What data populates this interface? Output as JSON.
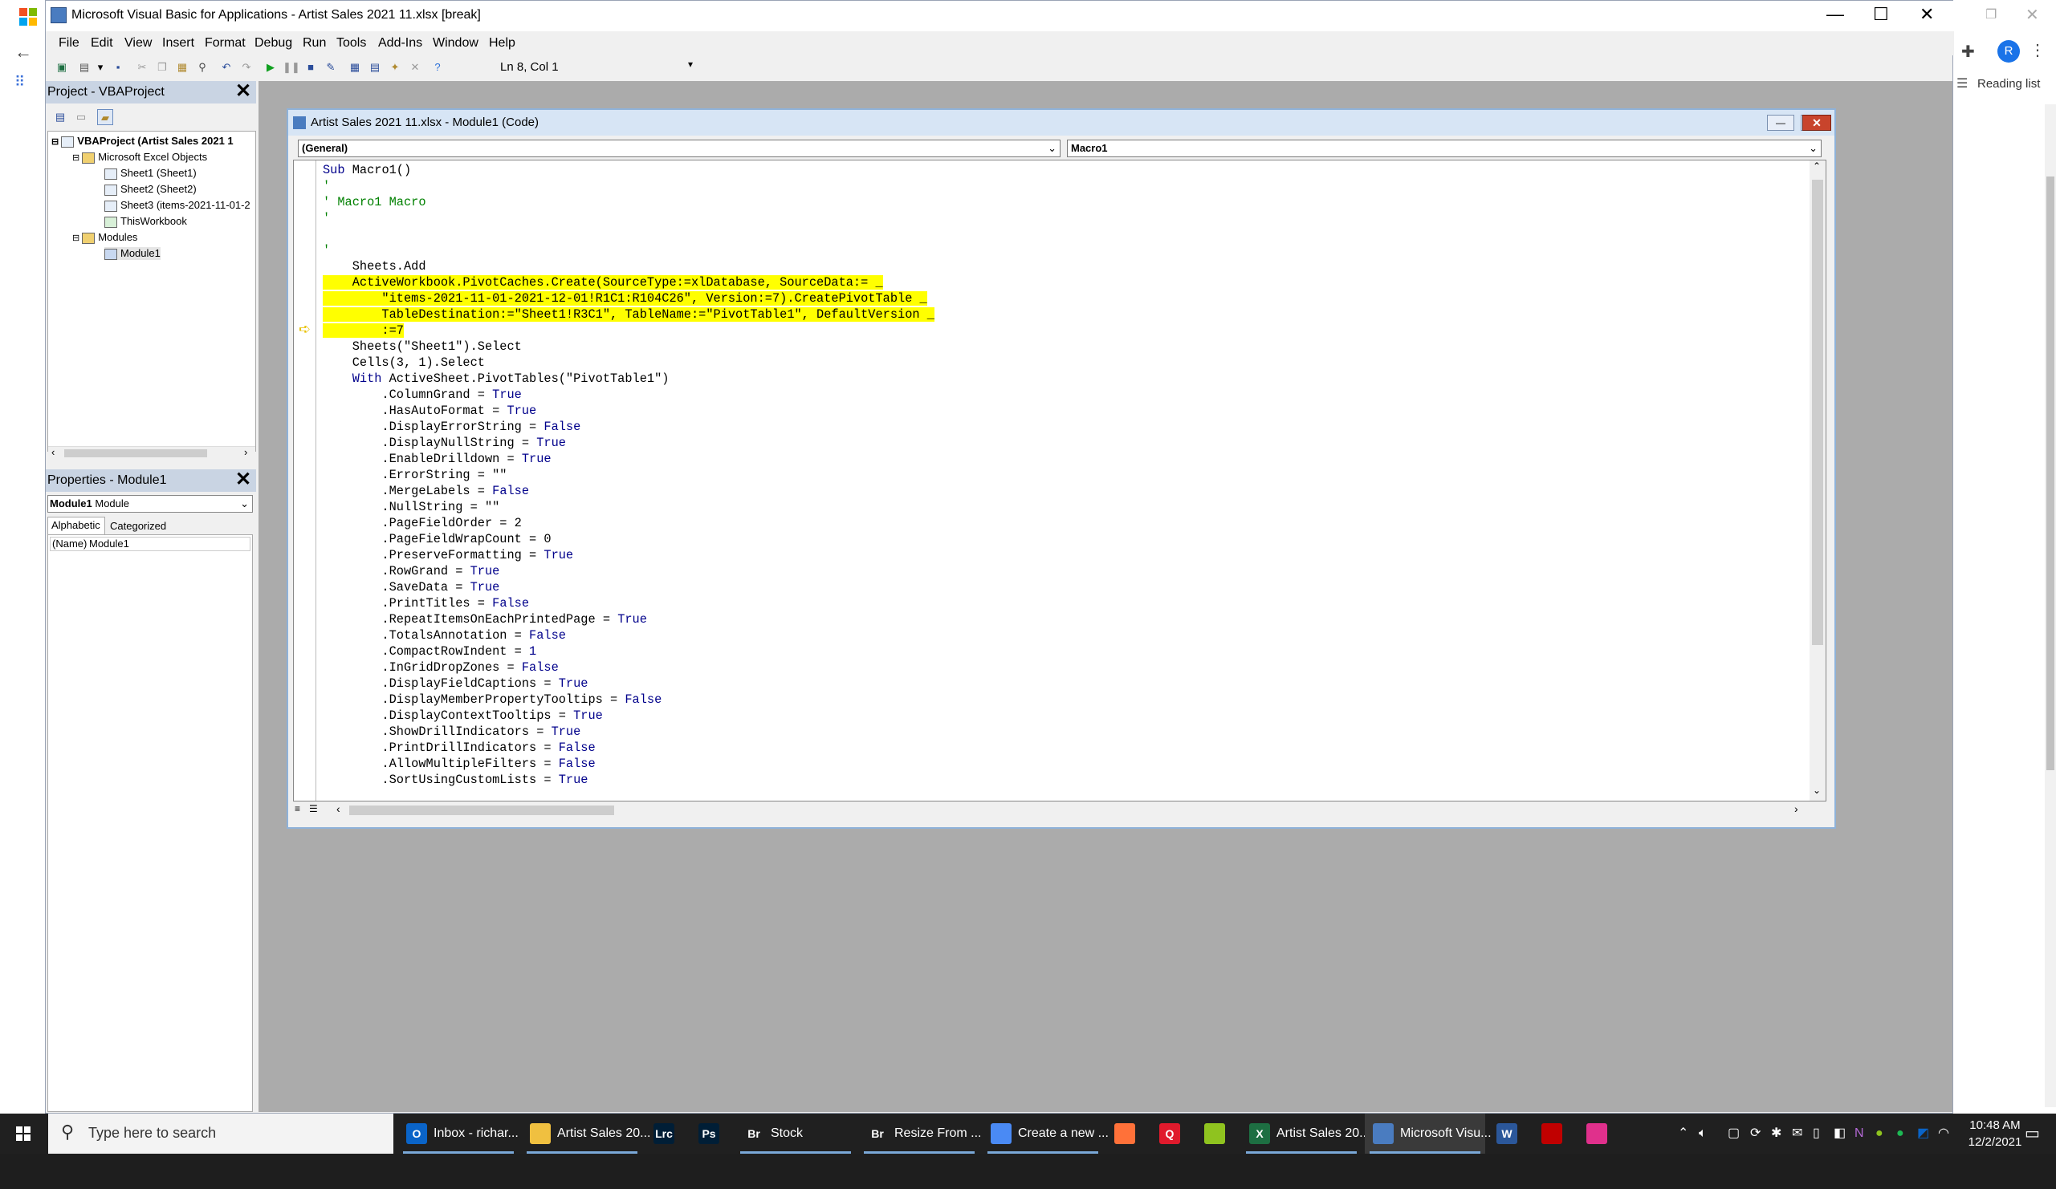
{
  "window_title": "Microsoft Visual Basic for Applications - Artist Sales 2021 11.xlsx [break]",
  "browser": {
    "reading_list": "Reading list",
    "avatar_initial": "R"
  },
  "menu": [
    "File",
    "Edit",
    "View",
    "Insert",
    "Format",
    "Debug",
    "Run",
    "Tools",
    "Add-Ins",
    "Window",
    "Help"
  ],
  "toolbar": {
    "position_text": "Ln 8, Col 1"
  },
  "project_panel": {
    "title": "Project - VBAProject",
    "tree": [
      {
        "label": "VBAProject (Artist Sales 2021 1",
        "icon": "vbaproject-icon"
      },
      {
        "label": "Microsoft Excel Objects",
        "icon": "folder-icon"
      },
      {
        "label": "Sheet1 (Sheet1)",
        "icon": "sheet-icon"
      },
      {
        "label": "Sheet2 (Sheet2)",
        "icon": "sheet-icon"
      },
      {
        "label": "Sheet3 (items-2021-11-01-2",
        "icon": "sheet-icon"
      },
      {
        "label": "ThisWorkbook",
        "icon": "workbook-icon"
      },
      {
        "label": "Modules",
        "icon": "folder-icon"
      },
      {
        "label": "Module1",
        "icon": "module-icon"
      }
    ]
  },
  "properties_panel": {
    "title": "Properties - Module1",
    "selected_object": "Module1",
    "selected_type": "Module",
    "tabs": [
      "Alphabetic",
      "Categorized"
    ],
    "rows": [
      {
        "name": "(Name)",
        "value": "Module1"
      }
    ]
  },
  "code_window": {
    "title": "Artist Sales 2021 11.xlsx - Module1 (Code)",
    "object_combo": "(General)",
    "procedure_combo": "Macro1",
    "lines": [
      {
        "t": "Sub Macro1()",
        "k": "sub"
      },
      {
        "t": "'",
        "k": "comment"
      },
      {
        "t": "' Macro1 Macro",
        "k": "comment"
      },
      {
        "t": "'",
        "k": "comment"
      },
      {
        "t": "",
        "k": "plain"
      },
      {
        "t": "'",
        "k": "comment"
      },
      {
        "t": "    Sheets.Add",
        "k": "plain"
      },
      {
        "t": "    ActiveWorkbook.PivotCaches.Create(SourceType:=xlDatabase, SourceData:= _",
        "k": "hl"
      },
      {
        "t": "        \"items-2021-11-01-2021-12-01!R1C1:R104C26\", Version:=7).CreatePivotTable _",
        "k": "hl"
      },
      {
        "t": "        TableDestination:=\"Sheet1!R3C1\", TableName:=\"PivotTable1\", DefaultVersion _",
        "k": "hl"
      },
      {
        "t": "        :=7",
        "k": "hl"
      },
      {
        "t": "    Sheets(\"Sheet1\").Select",
        "k": "plain"
      },
      {
        "t": "    Cells(3, 1).Select",
        "k": "plain"
      },
      {
        "t": "    With ActiveSheet.PivotTables(\"PivotTable1\")",
        "k": "with"
      },
      {
        "t": "        .ColumnGrand = ",
        "v": "True"
      },
      {
        "t": "        .HasAutoFormat = ",
        "v": "True"
      },
      {
        "t": "        .DisplayErrorString = ",
        "v": "False"
      },
      {
        "t": "        .DisplayNullString = ",
        "v": "True"
      },
      {
        "t": "        .EnableDrilldown = ",
        "v": "True"
      },
      {
        "t": "        .ErrorString = \"\"",
        "k": "plain"
      },
      {
        "t": "        .MergeLabels = ",
        "v": "False"
      },
      {
        "t": "        .NullString = \"\"",
        "k": "plain"
      },
      {
        "t": "        .PageFieldOrder = 2",
        "k": "plain"
      },
      {
        "t": "        .PageFieldWrapCount = 0",
        "k": "plain"
      },
      {
        "t": "        .PreserveFormatting = ",
        "v": "True"
      },
      {
        "t": "        .RowGrand = ",
        "v": "True"
      },
      {
        "t": "        .SaveData = ",
        "v": "True"
      },
      {
        "t": "        .PrintTitles = ",
        "v": "False"
      },
      {
        "t": "        .RepeatItemsOnEachPrintedPage = ",
        "v": "True"
      },
      {
        "t": "        .TotalsAnnotation = ",
        "v": "False"
      },
      {
        "t": "        .CompactRowIndent = ",
        "v": "1"
      },
      {
        "t": "        .InGridDropZones = ",
        "v": "False"
      },
      {
        "t": "        .DisplayFieldCaptions = ",
        "v": "True"
      },
      {
        "t": "        .DisplayMemberPropertyTooltips = ",
        "v": "False"
      },
      {
        "t": "        .DisplayContextTooltips = ",
        "v": "True"
      },
      {
        "t": "        .ShowDrillIndicators = ",
        "v": "True"
      },
      {
        "t": "        .PrintDrillIndicators = ",
        "v": "False"
      },
      {
        "t": "        .AllowMultipleFilters = ",
        "v": "False"
      },
      {
        "t": "        .SortUsingCustomLists = ",
        "v": "True"
      }
    ]
  },
  "taskbar": {
    "search_placeholder": "Type here to search",
    "apps": [
      {
        "label": "Inbox - richar...",
        "icon": "outlook-icon",
        "color": "#0a64c8",
        "glyph": "O"
      },
      {
        "label": "Artist Sales 20...",
        "icon": "file-explorer-icon",
        "color": "#f0c040",
        "glyph": ""
      },
      {
        "label": "",
        "icon": "lightroom-icon",
        "color": "#001e36",
        "glyph": "Lrc"
      },
      {
        "label": "",
        "icon": "photoshop-icon",
        "color": "#001e36",
        "glyph": "Ps"
      },
      {
        "label": "Stock",
        "icon": "bridge-icon",
        "color": "#202020",
        "glyph": "Br"
      },
      {
        "label": "Resize From ...",
        "icon": "bridge-icon",
        "color": "#202020",
        "glyph": "Br"
      },
      {
        "label": "Create a new ...",
        "icon": "chrome-icon",
        "color": "#4a8af4",
        "glyph": ""
      },
      {
        "label": "",
        "icon": "firefox-icon",
        "color": "#ff7139",
        "glyph": ""
      },
      {
        "label": "",
        "icon": "q-app-icon",
        "color": "#e01a2c",
        "glyph": "Q"
      },
      {
        "label": "",
        "icon": "green-ball-icon",
        "color": "#8fc31f",
        "glyph": ""
      },
      {
        "label": "Artist Sales 20...",
        "icon": "excel-icon",
        "color": "#1d6f42",
        "glyph": "X"
      },
      {
        "label": "Microsoft Visu...",
        "icon": "vba-icon",
        "color": "#4a7cc0",
        "glyph": ""
      },
      {
        "label": "",
        "icon": "word-icon",
        "color": "#2b579a",
        "glyph": "W"
      },
      {
        "label": "",
        "icon": "red-gem-icon",
        "color": "#c00000",
        "glyph": ""
      },
      {
        "label": "",
        "icon": "pinned-app-icon",
        "color": "#e0308c",
        "glyph": ""
      }
    ],
    "time": "10:48 AM",
    "date": "12/2/2021"
  }
}
